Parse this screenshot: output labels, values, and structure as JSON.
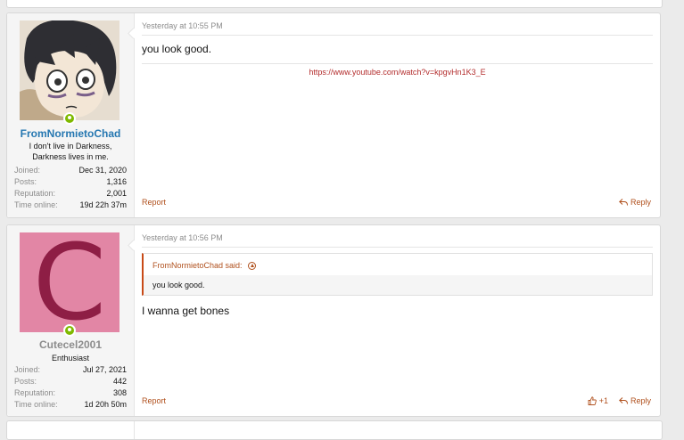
{
  "posts": [
    {
      "username": "FromNormietoChad",
      "user_title": "I don't live in Darkness, Darkness lives in me.",
      "stats": [
        {
          "label": "Joined:",
          "value": "Dec 31, 2020"
        },
        {
          "label": "Posts:",
          "value": "1,316"
        },
        {
          "label": "Reputation:",
          "value": "2,001"
        },
        {
          "label": "Time online:",
          "value": "19d 22h 37m"
        }
      ],
      "date": "Yesterday at 10:55 PM",
      "message": "you look good.",
      "signature_link": "https://www.youtube.com/watch?v=kpgvHn1K3_E",
      "report_label": "Report",
      "reply_label": "Reply"
    },
    {
      "username": "Cutecel2001",
      "avatar_letter": "C",
      "user_title": "Enthusiast",
      "stats": [
        {
          "label": "Joined:",
          "value": "Jul 27, 2021"
        },
        {
          "label": "Posts:",
          "value": "442"
        },
        {
          "label": "Reputation:",
          "value": "308"
        },
        {
          "label": "Time online:",
          "value": "1d 20h 50m"
        }
      ],
      "date": "Yesterday at 10:56 PM",
      "quote": {
        "author_label": "FromNormietoChad said:",
        "text": "you look good."
      },
      "message": "I wanna get bones",
      "report_label": "Report",
      "like_label": "+1",
      "reply_label": "Reply"
    }
  ],
  "colors": {
    "username_primary": "#2577b1",
    "username_secondary": "#8c8c8c",
    "accent": "#b0501d",
    "link": "#b32d2d",
    "online": "#7fb900",
    "avatar_bg": "#e286a5",
    "avatar_letter": "#8e1e45"
  }
}
